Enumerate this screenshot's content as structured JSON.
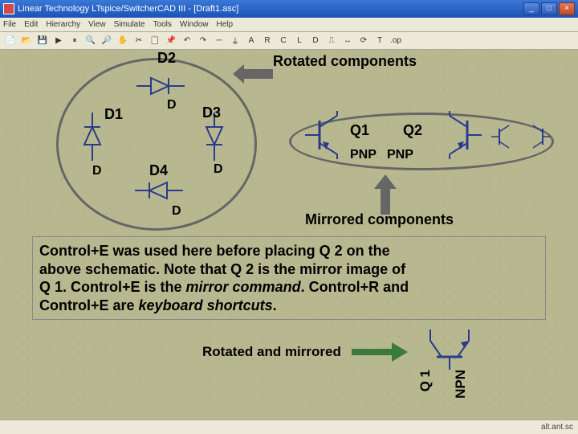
{
  "window": {
    "title": "Linear Technology LTspice/SwitcherCAD III - [Draft1.asc]",
    "buttons": {
      "min": "_",
      "max": "□",
      "close": "×"
    }
  },
  "menubar": [
    "File",
    "Edit",
    "Hierarchy",
    "View",
    "Simulate",
    "Tools",
    "Window",
    "Help"
  ],
  "annot": {
    "rotated": "Rotated components",
    "mirrored": "Mirrored components",
    "rotmir": "Rotated and mirrored"
  },
  "components": {
    "d1": {
      "name": "D1",
      "type": "D"
    },
    "d2": {
      "name": "D2",
      "type": "D"
    },
    "d3": {
      "name": "D3",
      "type": "D"
    },
    "d4": {
      "name": "D4",
      "type": "D"
    },
    "q1": {
      "name": "Q1",
      "type": "PNP"
    },
    "q2": {
      "name": "Q2",
      "type": "PNP"
    },
    "q1b": {
      "name": "Q 1",
      "type": "NPN"
    }
  },
  "textbox": {
    "l1": "Control+E was used here before placing Q 2 on the",
    "l2": "above schematic.  Note that Q 2 is the mirror image of",
    "l3a": "Q 1.  Control+E is the ",
    "l3b": "mirror command",
    "l3c": ".  Control+R and",
    "l4a": "Control+E are ",
    "l4b": "keyboard shortcuts",
    "l4c": "."
  },
  "statusbar": "alt.ant.sc"
}
